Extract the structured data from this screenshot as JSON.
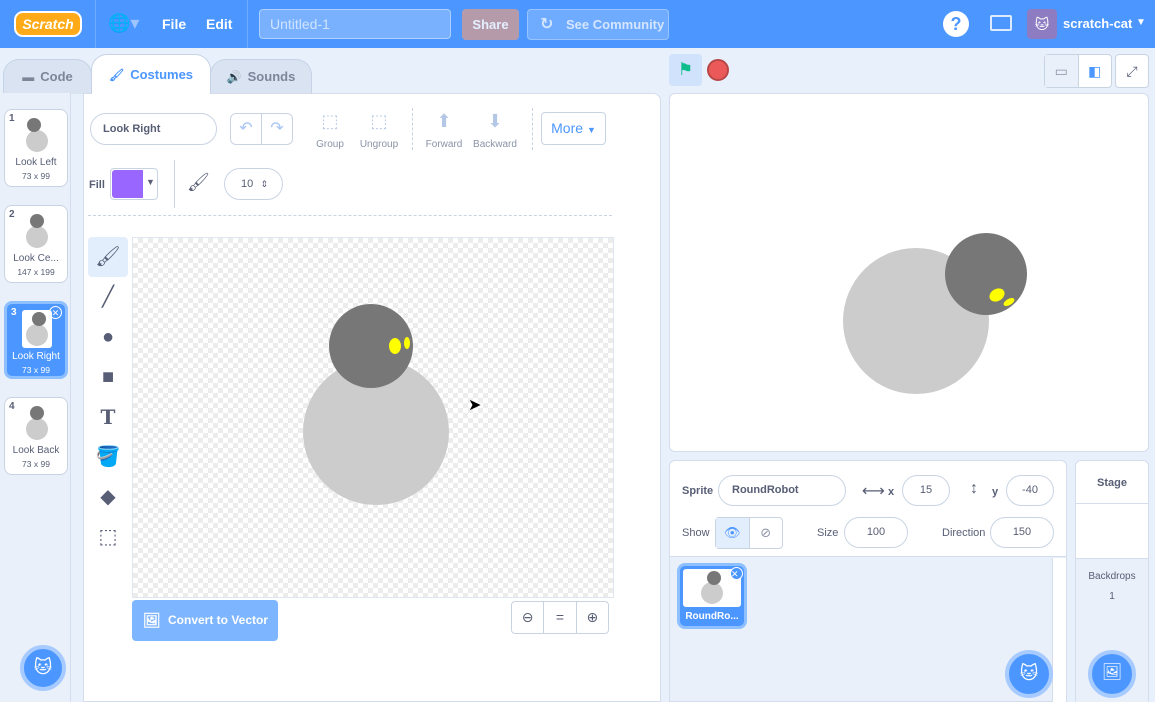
{
  "menubar": {
    "logo": "Scratch",
    "file": "File",
    "edit": "Edit",
    "project_title": "Untitled-1",
    "share": "Share",
    "see_community": "See Community",
    "username": "scratch-cat"
  },
  "tabs": [
    {
      "label": "Code",
      "icon": "code-icon"
    },
    {
      "label": "Costumes",
      "icon": "brush-icon",
      "active": true
    },
    {
      "label": "Sounds",
      "icon": "speaker-icon"
    }
  ],
  "costumes": [
    {
      "num": "1",
      "name": "Look Left",
      "size": "73 x 99"
    },
    {
      "num": "2",
      "name": "Look Ce...",
      "size": "147 x 199"
    },
    {
      "num": "3",
      "name": "Look Right",
      "size": "73 x 99",
      "selected": true
    },
    {
      "num": "4",
      "name": "Look Back",
      "size": "73 x 99"
    }
  ],
  "paint": {
    "costume_name": "Look Right",
    "group": "Group",
    "ungroup": "Ungroup",
    "forward": "Forward",
    "backward": "Backward",
    "more": "More",
    "fill_label": "Fill",
    "fill_color": "#9966ff",
    "brush_size": "10",
    "convert": "Convert to Vector",
    "zoom_reset": "="
  },
  "sprite": {
    "sprite_label": "Sprite",
    "name": "RoundRobot",
    "x_label": "x",
    "x": "15",
    "y_label": "y",
    "y": "-40",
    "show_label": "Show",
    "size_label": "Size",
    "size": "100",
    "direction_label": "Direction",
    "direction": "150",
    "tile_name": "RoundRo..."
  },
  "stage_panel": {
    "title": "Stage",
    "backdrops_label": "Backdrops",
    "backdrops_count": "1"
  },
  "colors": {
    "accent": "#4c97ff",
    "fill": "#9966ff",
    "robot_body": "#cccccc",
    "robot_head": "#777777",
    "robot_eye": "#ffff00"
  }
}
